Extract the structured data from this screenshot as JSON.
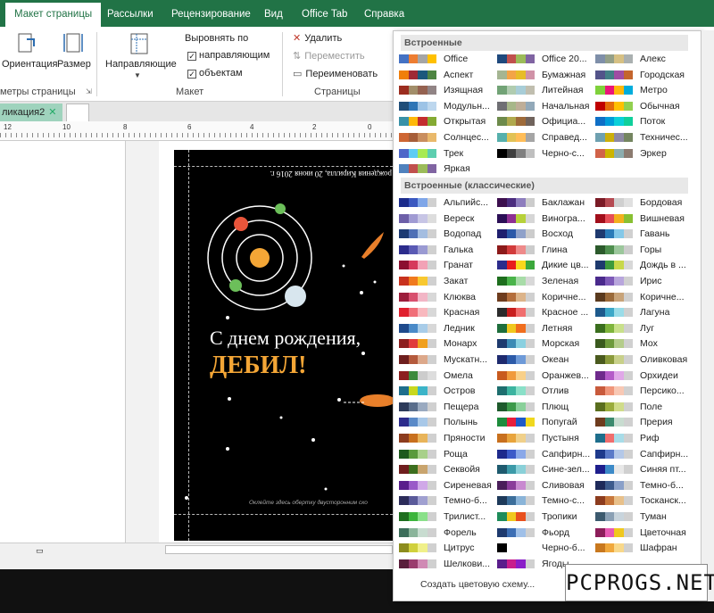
{
  "ribbon_tabs": [
    "Макет страницы",
    "Рассылки",
    "Рецензирование",
    "Вид",
    "Office Tab",
    "Справка"
  ],
  "ribbon": {
    "orientation": "Ориентация",
    "size": "Размер",
    "group_page": "метры страницы",
    "guides": "Направляющие",
    "align_by": "Выровнять по",
    "align_guides": "направляющим",
    "align_objects": "объектам",
    "group_layout": "Макет",
    "delete": "Удалить",
    "move": "Переместить",
    "rename": "Переименовать",
    "group_pages": "Страницы"
  },
  "doc_tab": "ликация2",
  "card": {
    "top_text": "рождения Кирилла, 20 июня 2016 г.",
    "greeting": "С днем рождения,",
    "name": "ДЕБИЛ!",
    "bottom_text": "Оклейте здесь обертку двусторонним ско"
  },
  "panel": {
    "section1": "Встроенные",
    "section2": "Встроенные (классические)",
    "create": "Создать цветовую схему...",
    "builtin": [
      {
        "n": "Office",
        "c": [
          "#4472c4",
          "#ed7d31",
          "#a5a5a5",
          "#ffc000"
        ]
      },
      {
        "n": "Office 20...",
        "c": [
          "#1f497d",
          "#c0504d",
          "#9bbb59",
          "#8064a2"
        ]
      },
      {
        "n": "Алекс",
        "c": [
          "#7f8fa9",
          "#94a088",
          "#d6c083",
          "#aab0b0"
        ]
      },
      {
        "n": "Аспект",
        "c": [
          "#f07f09",
          "#9f2936",
          "#1b587c",
          "#4e8542"
        ]
      },
      {
        "n": "Бумажная",
        "c": [
          "#a5b592",
          "#f3a447",
          "#e7bc29",
          "#d092a7"
        ]
      },
      {
        "n": "Городская",
        "c": [
          "#53548a",
          "#438086",
          "#a04da3",
          "#c4652d"
        ]
      },
      {
        "n": "Изящная",
        "c": [
          "#9b2d1f",
          "#a28e6a",
          "#956251",
          "#918485"
        ]
      },
      {
        "n": "Литейная",
        "c": [
          "#72a376",
          "#b0ccb0",
          "#a8cdd7",
          "#c0beaf"
        ]
      },
      {
        "n": "Метро",
        "c": [
          "#7fd13b",
          "#ea157a",
          "#feb80a",
          "#00addc"
        ]
      },
      {
        "n": "Модульн...",
        "c": [
          "#1f4e79",
          "#2e75b6",
          "#9dc3e6",
          "#bdd7ee"
        ]
      },
      {
        "n": "Начальная",
        "c": [
          "#6f6f74",
          "#a7b789",
          "#beae98",
          "#92a9b9"
        ]
      },
      {
        "n": "Обычная",
        "c": [
          "#c00000",
          "#e46c0a",
          "#ffc000",
          "#92d050"
        ]
      },
      {
        "n": "Открытая",
        "c": [
          "#3891a7",
          "#feb80a",
          "#c32d2e",
          "#84aa33"
        ]
      },
      {
        "n": "Официа...",
        "c": [
          "#6d8a4b",
          "#b0a94e",
          "#9e6b3a",
          "#70635c"
        ]
      },
      {
        "n": "Поток",
        "c": [
          "#0f6fc6",
          "#009dd9",
          "#0bd0d9",
          "#10cf9b"
        ]
      },
      {
        "n": "Солнцес...",
        "c": [
          "#ce6633",
          "#a65e39",
          "#c98e5e",
          "#e9b96b"
        ]
      },
      {
        "n": "Справед...",
        "c": [
          "#56b0ac",
          "#e1c256",
          "#ffbd58",
          "#a5a5a5"
        ]
      },
      {
        "n": "Техничес...",
        "c": [
          "#6ea0b0",
          "#ccaf0a",
          "#8d89a4",
          "#748560"
        ]
      },
      {
        "n": "Трек",
        "c": [
          "#4e67c8",
          "#5eccf3",
          "#a7ea52",
          "#5dceaf"
        ]
      },
      {
        "n": "Черно-с...",
        "c": [
          "#000000",
          "#3f3f3f",
          "#7f7f7f",
          "#bfbfbf"
        ]
      },
      {
        "n": "Эркер",
        "c": [
          "#d16349",
          "#ccb400",
          "#8cadae",
          "#8c7b70"
        ]
      },
      {
        "n": "Яркая",
        "c": [
          "#4f81bd",
          "#c0504d",
          "#9bbb59",
          "#8064a2"
        ]
      }
    ],
    "classic": [
      {
        "n": "Альпийс...",
        "c": [
          "#1c2c8c",
          "#3a58c0",
          "#7fa6e8",
          "#d0d0d0"
        ]
      },
      {
        "n": "Баклажан",
        "c": [
          "#3c0f4e",
          "#4b2c7e",
          "#8d7dbd",
          "#cccccc"
        ]
      },
      {
        "n": "Бордовая",
        "c": [
          "#7a1b26",
          "#b54a52",
          "#cfcfcf",
          "#e0e0e0"
        ]
      },
      {
        "n": "Вереск",
        "c": [
          "#6d5fa8",
          "#a09bd3",
          "#c7c5e5",
          "#dddddd"
        ]
      },
      {
        "n": "Виногра...",
        "c": [
          "#2b0f56",
          "#8e2f93",
          "#b7d13a",
          "#d6d6d6"
        ]
      },
      {
        "n": "Вишневая",
        "c": [
          "#a10f1b",
          "#e64e57",
          "#f2b01e",
          "#88c032"
        ]
      },
      {
        "n": "Водопад",
        "c": [
          "#1c3a73",
          "#4e6fb5",
          "#a4bde0",
          "#d0d0d0"
        ]
      },
      {
        "n": "Восход",
        "c": [
          "#1f1f6f",
          "#2b58a8",
          "#8fa1c9",
          "#cccccc"
        ]
      },
      {
        "n": "Гавань",
        "c": [
          "#1f3a6f",
          "#2a7bb8",
          "#84c8e8",
          "#d0d0d0"
        ]
      },
      {
        "n": "Галька",
        "c": [
          "#2c2c8c",
          "#5a5ab4",
          "#9a9ad2",
          "#d0d0d0"
        ]
      },
      {
        "n": "Глина",
        "c": [
          "#8c1a1a",
          "#d23b3b",
          "#ee8a8a",
          "#cccccc"
        ]
      },
      {
        "n": "Горы",
        "c": [
          "#2c5a2c",
          "#4f8f4f",
          "#9cc79c",
          "#cccccc"
        ]
      },
      {
        "n": "Гранат",
        "c": [
          "#8c1030",
          "#d63a5c",
          "#f2a2b6",
          "#d0d0d0"
        ]
      },
      {
        "n": "Дикие цв...",
        "c": [
          "#2c2c8c",
          "#e81c1c",
          "#f8d81c",
          "#3ca83c"
        ]
      },
      {
        "n": "Дождь в ...",
        "c": [
          "#1e3a6e",
          "#3c9a3c",
          "#c8d84a",
          "#d8d8d8"
        ]
      },
      {
        "n": "Закат",
        "c": [
          "#c8321e",
          "#f07a1e",
          "#f8c830",
          "#d0d0d0"
        ]
      },
      {
        "n": "Зеленая",
        "c": [
          "#1e6e1e",
          "#4ab44a",
          "#a8dca8",
          "#d8d8d8"
        ]
      },
      {
        "n": "Ирис",
        "c": [
          "#4a2a8c",
          "#7e5ab8",
          "#b8a6dc",
          "#d0d0d0"
        ]
      },
      {
        "n": "Клюква",
        "c": [
          "#9c1e3c",
          "#d8506e",
          "#f2b6c6",
          "#d8d8d8"
        ]
      },
      {
        "n": "Коричне...",
        "c": [
          "#6e3c1e",
          "#b46e3c",
          "#dcb48a",
          "#d0d0d0"
        ]
      },
      {
        "n": "Коричне...",
        "c": [
          "#5a3a1e",
          "#9a6a3a",
          "#c8a47a",
          "#d0d0d0"
        ]
      },
      {
        "n": "Красная",
        "c": [
          "#e0202e",
          "#f06e78",
          "#f8b8be",
          "#d8d8d8"
        ]
      },
      {
        "n": "Красное ...",
        "c": [
          "#2c2c2c",
          "#c81e1e",
          "#f06e6e",
          "#d0d0d0"
        ]
      },
      {
        "n": "Лагуна",
        "c": [
          "#1e5a8c",
          "#3ca8c8",
          "#9adce8",
          "#d0d0d0"
        ]
      },
      {
        "n": "Ледник",
        "c": [
          "#1e4a8c",
          "#4a8ac8",
          "#a8cce8",
          "#d8d8d8"
        ]
      },
      {
        "n": "Летняя",
        "c": [
          "#1e6e3c",
          "#f0c81e",
          "#f06e1e",
          "#d0d0d0"
        ]
      },
      {
        "n": "Луг",
        "c": [
          "#3a6e1e",
          "#7eb43c",
          "#c8e08a",
          "#d0d0d0"
        ]
      },
      {
        "n": "Монарх",
        "c": [
          "#8c1e1e",
          "#e03c3c",
          "#f0a01e",
          "#d0d0d0"
        ]
      },
      {
        "n": "Морская",
        "c": [
          "#1e3a6e",
          "#3c8ab4",
          "#8ad0e0",
          "#d0d0d0"
        ]
      },
      {
        "n": "Мох",
        "c": [
          "#3a5a1e",
          "#6e9a3c",
          "#b4cc8a",
          "#d0d0d0"
        ]
      },
      {
        "n": "Мускатн...",
        "c": [
          "#6e1e1e",
          "#b45a3c",
          "#dca88a",
          "#d0d0d0"
        ]
      },
      {
        "n": "Океан",
        "c": [
          "#1e2a6e",
          "#2c5aa8",
          "#6e9ad8",
          "#d0d0d0"
        ]
      },
      {
        "n": "Оливковая",
        "c": [
          "#4a5a1e",
          "#8a9a3c",
          "#c8d08a",
          "#d0d0d0"
        ]
      },
      {
        "n": "Омела",
        "c": [
          "#8c1e1e",
          "#3c8a3c",
          "#cccccc",
          "#dddddd"
        ]
      },
      {
        "n": "Оранжев...",
        "c": [
          "#c85a1e",
          "#f09a3c",
          "#f8d08a",
          "#d0d0d0"
        ]
      },
      {
        "n": "Орхидеи",
        "c": [
          "#6e2a8c",
          "#b45ac8",
          "#e0a8e8",
          "#d0d0d0"
        ]
      },
      {
        "n": "Остров",
        "c": [
          "#1e6e8c",
          "#c8d81e",
          "#3cb4c8",
          "#d0d0d0"
        ]
      },
      {
        "n": "Отлив",
        "c": [
          "#1e6e6e",
          "#3cb4a0",
          "#8ae0c8",
          "#d0d0d0"
        ]
      },
      {
        "n": "Персико...",
        "c": [
          "#c85a3c",
          "#f0967a",
          "#f8c8b4",
          "#d0d0d0"
        ]
      },
      {
        "n": "Пещера",
        "c": [
          "#2c3a5a",
          "#5a6e8c",
          "#9aaac0",
          "#d0d0d0"
        ]
      },
      {
        "n": "Плющ",
        "c": [
          "#1e5a2c",
          "#3c9a4a",
          "#8ad09a",
          "#d0d0d0"
        ]
      },
      {
        "n": "Поле",
        "c": [
          "#5a6e1e",
          "#9aac3c",
          "#d0dc8a",
          "#d0d0d0"
        ]
      },
      {
        "n": "Полынь",
        "c": [
          "#2c2c8c",
          "#5a8ac8",
          "#a8c8e8",
          "#d0d0d0"
        ]
      },
      {
        "n": "Попугай",
        "c": [
          "#1e8c3c",
          "#e81e3c",
          "#1e5ac8",
          "#f0d81e"
        ]
      },
      {
        "n": "Прерия",
        "c": [
          "#6e3c1e",
          "#3c8a6e",
          "#c8dcd0",
          "#d0d0d0"
        ]
      },
      {
        "n": "Пряности",
        "c": [
          "#8c3c1e",
          "#c8701e",
          "#e8b45a",
          "#d0d0d0"
        ]
      },
      {
        "n": "Пустыня",
        "c": [
          "#c8701e",
          "#e8a43c",
          "#f0d08a",
          "#d0d0d0"
        ]
      },
      {
        "n": "Риф",
        "c": [
          "#1e6e8c",
          "#f06e6e",
          "#a8dce8",
          "#d0d0d0"
        ]
      },
      {
        "n": "Роща",
        "c": [
          "#1e5a1e",
          "#5a9a3c",
          "#a8d08a",
          "#d0d0d0"
        ]
      },
      {
        "n": "Сапфирн...",
        "c": [
          "#1e2a8c",
          "#3c5ac8",
          "#8aa8e8",
          "#d0d0d0"
        ]
      },
      {
        "n": "Сапфирн...",
        "c": [
          "#1e3a8c",
          "#5a7ac8",
          "#b4c8e8",
          "#d0d0d0"
        ]
      },
      {
        "n": "Секвойя",
        "c": [
          "#6e1e1e",
          "#3c6e1e",
          "#c8a46e",
          "#d0d0d0"
        ]
      },
      {
        "n": "Сине-зел...",
        "c": [
          "#1e5a6e",
          "#3c9aa8",
          "#8ad0d8",
          "#d0d0d0"
        ]
      },
      {
        "n": "Синяя пт...",
        "c": [
          "#1e1e8c",
          "#3c8ac8",
          "#e8e8e8",
          "#d0d0d0"
        ]
      },
      {
        "n": "Сиреневая",
        "c": [
          "#5a1e8c",
          "#9a5ac8",
          "#d0a8e8",
          "#d0d0d0"
        ]
      },
      {
        "n": "Сливовая",
        "c": [
          "#4a1e5a",
          "#8a3c9a",
          "#c88ad0",
          "#d0d0d0"
        ]
      },
      {
        "n": "Темно-б...",
        "c": [
          "#1e2a5a",
          "#3c5a8c",
          "#8aa0c8",
          "#d0d0d0"
        ]
      },
      {
        "n": "Темно-б...",
        "c": [
          "#2c2c5a",
          "#5a5a9a",
          "#a0a0d0",
          "#d0d0d0"
        ]
      },
      {
        "n": "Темно-с...",
        "c": [
          "#1e3a5a",
          "#3c6e9a",
          "#8ab4d8",
          "#d0d0d0"
        ]
      },
      {
        "n": "Тосканск...",
        "c": [
          "#8c3c1e",
          "#c8783c",
          "#e8c08a",
          "#d0d0d0"
        ]
      },
      {
        "n": "Трилист...",
        "c": [
          "#1e6e1e",
          "#3cb43c",
          "#8ae08a",
          "#d0d0d0"
        ]
      },
      {
        "n": "Тропики",
        "c": [
          "#1e8c5a",
          "#f0c81e",
          "#e8501e",
          "#d0d0d0"
        ]
      },
      {
        "n": "Туман",
        "c": [
          "#3c5a6e",
          "#8aa0b4",
          "#c8d4dc",
          "#d0d0d0"
        ]
      },
      {
        "n": "Форель",
        "c": [
          "#3c6e5a",
          "#8ab49a",
          "#c8dcd0",
          "#d0d0d0"
        ]
      },
      {
        "n": "Фьорд",
        "c": [
          "#1e3a6e",
          "#3c6eb4",
          "#a0c0e8",
          "#d0d0d0"
        ]
      },
      {
        "n": "Цветочная",
        "c": [
          "#8c1e5a",
          "#e85ab4",
          "#f0c81e",
          "#d0d0d0"
        ]
      },
      {
        "n": "Цитрус",
        "c": [
          "#8c8c1e",
          "#d0d03c",
          "#f0f08a",
          "#d0d0d0"
        ]
      },
      {
        "n": "Черно-б...",
        "c": [
          "#000000",
          "#ffffff",
          "#ffffff",
          "#ffffff"
        ]
      },
      {
        "n": "Шафран",
        "c": [
          "#c8781e",
          "#f0a83c",
          "#f8d88a",
          "#d0d0d0"
        ]
      },
      {
        "n": "Шелкови...",
        "c": [
          "#5a1e3c",
          "#9a3c6e",
          "#d08ab4",
          "#d0d0d0"
        ]
      },
      {
        "n": "Ягоды",
        "c": [
          "#5a1e8c",
          "#c81e8c",
          "#8a1ec8",
          "#d0d0d0"
        ]
      }
    ]
  },
  "watermark": "PCPROGS.NET",
  "colors": {
    "accent": "#217346",
    "doc_tab": "#9fd3bd"
  }
}
